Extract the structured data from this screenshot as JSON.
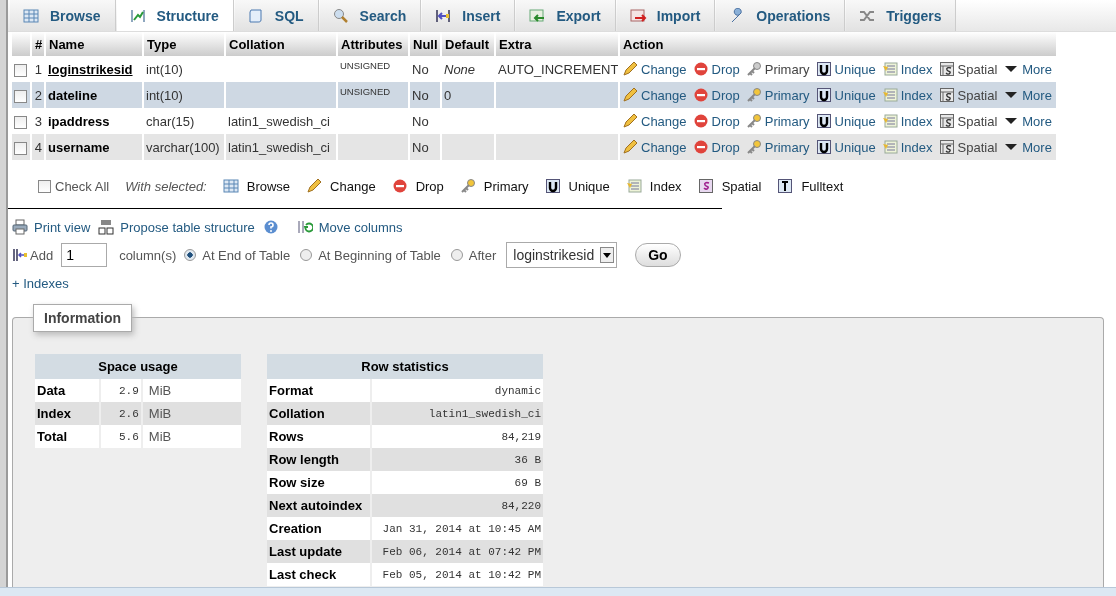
{
  "tabs": [
    {
      "label": "Browse",
      "selected": false
    },
    {
      "label": "Structure",
      "selected": true
    },
    {
      "label": "SQL",
      "selected": false
    },
    {
      "label": "Search",
      "selected": false
    },
    {
      "label": "Insert",
      "selected": false
    },
    {
      "label": "Export",
      "selected": false
    },
    {
      "label": "Import",
      "selected": false
    },
    {
      "label": "Operations",
      "selected": false
    },
    {
      "label": "Triggers",
      "selected": false
    }
  ],
  "table": {
    "columns": [
      "#",
      "Name",
      "Type",
      "Collation",
      "Attributes",
      "Null",
      "Default",
      "Extra",
      "Action"
    ],
    "rows": [
      {
        "checked": false,
        "highlighted": false,
        "number": "1",
        "name": "loginstrikesid",
        "primary": true,
        "type": "int(10)",
        "collation": "",
        "attributes": "UNSIGNED",
        "null": "No",
        "default": "None",
        "extra": "AUTO_INCREMENT",
        "actions": [
          {
            "label": "Change",
            "disabled": false
          },
          {
            "label": "Drop",
            "disabled": false
          },
          {
            "label": "Primary",
            "disabled": true
          },
          {
            "label": "Unique",
            "disabled": false
          },
          {
            "label": "Index",
            "disabled": false
          },
          {
            "label": "Spatial",
            "disabled": true
          },
          {
            "label": "More",
            "disabled": false
          }
        ]
      },
      {
        "checked": false,
        "highlighted": true,
        "number": "2",
        "name": "dateline",
        "primary": false,
        "type": "int(10)",
        "collation": "",
        "attributes": "UNSIGNED",
        "null": "No",
        "default": "0",
        "extra": "",
        "actions": [
          {
            "label": "Change",
            "disabled": false
          },
          {
            "label": "Drop",
            "disabled": false
          },
          {
            "label": "Primary",
            "disabled": false
          },
          {
            "label": "Unique",
            "disabled": false
          },
          {
            "label": "Index",
            "disabled": false
          },
          {
            "label": "Spatial",
            "disabled": true
          },
          {
            "label": "More",
            "disabled": false
          }
        ]
      },
      {
        "checked": false,
        "highlighted": false,
        "number": "3",
        "name": "ipaddress",
        "primary": false,
        "type": "char(15)",
        "collation": "latin1_swedish_ci",
        "attributes": "",
        "null": "No",
        "default": "",
        "extra": "",
        "actions": [
          {
            "label": "Change",
            "disabled": false
          },
          {
            "label": "Drop",
            "disabled": false
          },
          {
            "label": "Primary",
            "disabled": false
          },
          {
            "label": "Unique",
            "disabled": false
          },
          {
            "label": "Index",
            "disabled": false
          },
          {
            "label": "Spatial",
            "disabled": true
          },
          {
            "label": "More",
            "disabled": false
          }
        ]
      },
      {
        "checked": false,
        "highlighted": false,
        "number": "4",
        "name": "username",
        "primary": false,
        "type": "varchar(100)",
        "collation": "latin1_swedish_ci",
        "attributes": "",
        "null": "No",
        "default": "",
        "extra": "",
        "actions": [
          {
            "label": "Change",
            "disabled": false
          },
          {
            "label": "Drop",
            "disabled": false
          },
          {
            "label": "Primary",
            "disabled": false
          },
          {
            "label": "Unique",
            "disabled": false
          },
          {
            "label": "Index",
            "disabled": false
          },
          {
            "label": "Spatial",
            "disabled": true
          },
          {
            "label": "More",
            "disabled": false
          }
        ]
      }
    ]
  },
  "bulk": {
    "check_all": {
      "label": "Check All",
      "checked": false
    },
    "with_selected": "With selected:",
    "actions": [
      "Browse",
      "Change",
      "Drop",
      "Primary",
      "Unique",
      "Index",
      "Spatial",
      "Fulltext"
    ]
  },
  "links": [
    "Print view",
    "Propose table structure",
    "Move columns"
  ],
  "add_column": {
    "label": "Add",
    "value": "1",
    "unit": "column(s)",
    "positions": [
      {
        "label": "At End of Table",
        "selected": true
      },
      {
        "label": "At Beginning of Table",
        "selected": false
      },
      {
        "label": "After",
        "selected": false
      }
    ],
    "after_column": "loginstrikesid",
    "go": "Go"
  },
  "indexes_link": "+ Indexes",
  "information": {
    "legend": "Information",
    "space_usage": {
      "title": "Space usage",
      "rows": [
        {
          "label": "Data",
          "value": "2.9",
          "unit": "MiB"
        },
        {
          "label": "Index",
          "value": "2.6",
          "unit": "MiB"
        },
        {
          "label": "Total",
          "value": "5.6",
          "unit": "MiB"
        }
      ]
    },
    "row_statistics": {
      "title": "Row statistics",
      "rows": [
        {
          "label": "Format",
          "value": "dynamic"
        },
        {
          "label": "Collation",
          "value": "latin1_swedish_ci"
        },
        {
          "label": "Rows",
          "value": "84,219"
        },
        {
          "label": "Row length",
          "value": "36 B"
        },
        {
          "label": "Row size",
          "value": "69 B"
        },
        {
          "label": "Next autoindex",
          "value": "84,220"
        },
        {
          "label": "Creation",
          "value": "Jan 31, 2014 at 10:45 AM"
        },
        {
          "label": "Last update",
          "value": "Feb 06, 2014 at 07:42 PM"
        },
        {
          "label": "Last check",
          "value": "Feb 05, 2014 at 10:42 PM"
        }
      ]
    }
  }
}
